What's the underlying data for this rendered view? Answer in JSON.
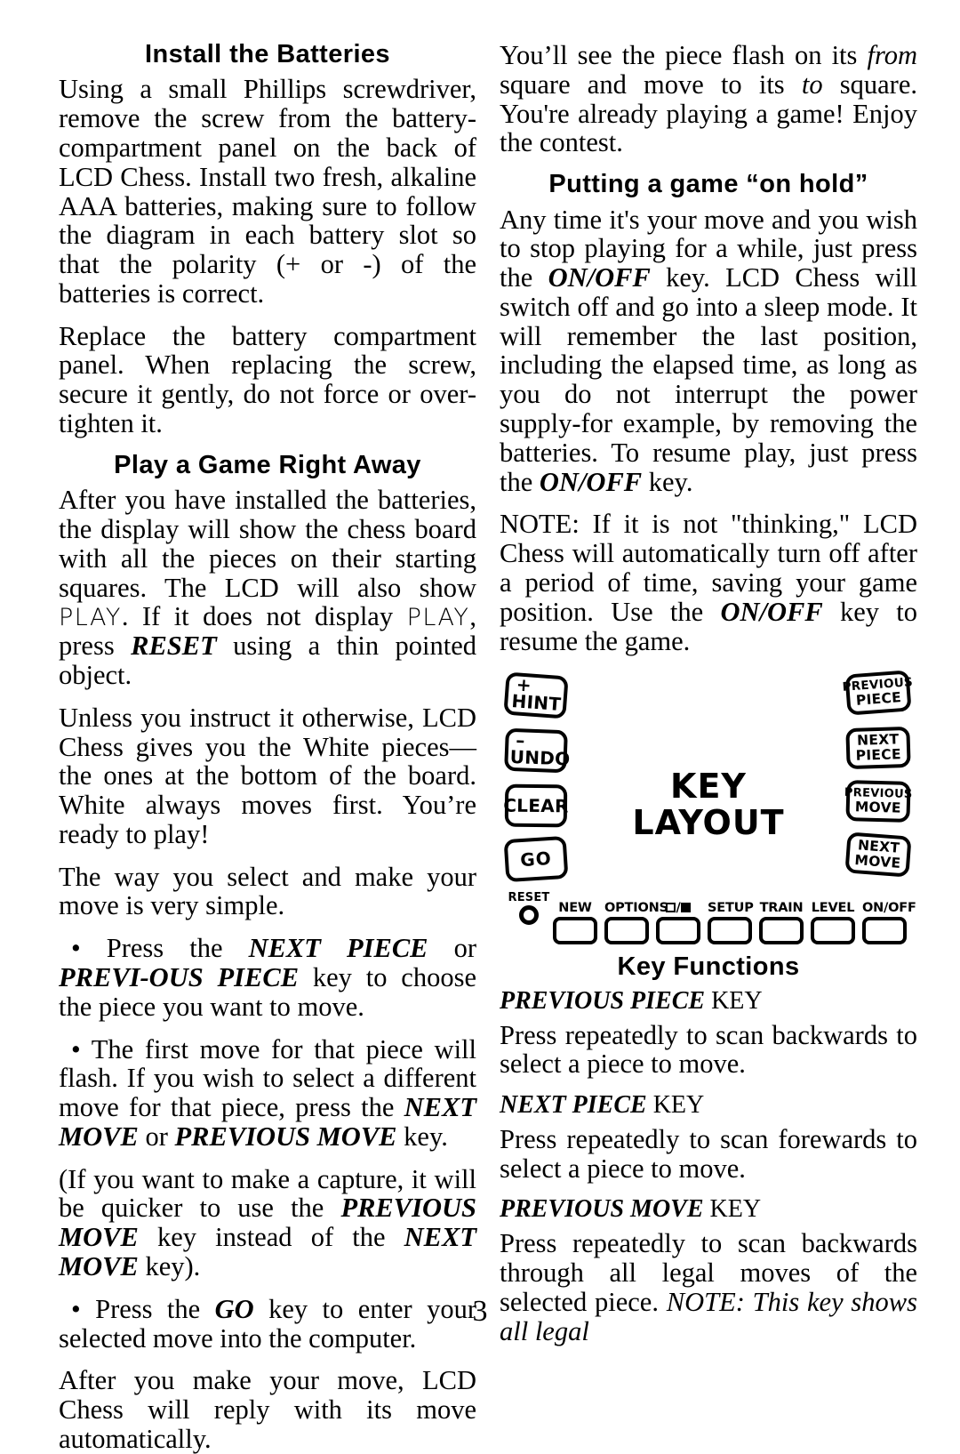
{
  "page_number": "3",
  "left_column": {
    "heading_1": "Install the Batteries",
    "para_1": "Using a small Phillips screwdriver, remove the screw from the battery-compartment panel on the back of LCD Chess.  Install two fresh, alkaline AAA batteries, making sure to follow the diagram in each battery slot so that the polarity (+ or -) of the batteries is correct.",
    "para_2": "Replace the battery compartment panel. When replacing the screw, secure it gently,  do not force or over-tighten it.",
    "heading_2": "Play a Game Right Away",
    "para_3_a": "After you have installed the batteries, the display will show the chess board with all the pieces on their starting squares. The LCD will also show ",
    "para_3_lcd1": "PLAY",
    "para_3_b": ". If it does not display ",
    "para_3_lcd2": "PLAY",
    "para_3_c": ", press ",
    "para_3_key": "RESET",
    "para_3_d": " using a thin pointed object.",
    "para_4": "Unless you instruct it otherwise, LCD Chess gives you the White pieces—the ones at the bottom of the board. White always moves first. You’re ready to play!",
    "para_5": "The way you select and make your move is very simple.",
    "bullet_1_a": "• Press the ",
    "bullet_1_key1": "NEXT PIECE",
    "bullet_1_b": " or ",
    "bullet_1_key2": "PREVI-OUS   PIECE",
    "bullet_1_c": " key to choose the piece you want to move.",
    "bullet_2_a": "• The first move for that piece will flash. If you wish to select a different move for that piece, press the ",
    "bullet_2_key1": "NEXT MOVE",
    "bullet_2_b": " or ",
    "bullet_2_key2": "PREVIOUS MOVE",
    "bullet_2_c": " key.",
    "para_6_a": "(If you want to make a capture, it will be quicker to use the ",
    "para_6_key1": "PREVIOUS MOVE",
    "para_6_b": " key instead of the ",
    "para_6_key2": "NEXT MOVE",
    "para_6_c": " key).",
    "bullet_3_a": "• Press the ",
    "bullet_3_key": "GO",
    "bullet_3_b": " key to enter your  selected move into the computer.",
    "para_7": "After you make your move, LCD Chess will reply with its move automatically."
  },
  "right_column": {
    "para_1_a": "You’ll see the piece flash on its ",
    "para_1_em1": "from",
    "para_1_b": " square and move to its ",
    "para_1_em2": "to",
    "para_1_c": " square. You're already playing a game! Enjoy the contest.",
    "heading_1": "Putting a game “on hold”",
    "para_2_a": "Any time it's your move and you wish to stop playing for a while, just press the ",
    "para_2_key1": "ON/OFF",
    "para_2_b": " key. LCD Chess will switch off and go into a sleep mode. It will remember the last position, including the elapsed time, as long as you do not interrupt the power supply-for example, by removing the batteries.  To resume play, just press the ",
    "para_2_key2": "ON/OFF",
    "para_2_c": " key.",
    "para_3_a": "NOTE: If it is not \"thinking,\" LCD Chess will automatically turn off after a period of time, saving your game position. Use the ",
    "para_3_key": "ON/OFF",
    "para_3_b": " key to resume the game.",
    "heading_2": "Key Functions",
    "functions": [
      {
        "name": "PREVIOUS PIECE",
        "key_word": " KEY",
        "text": "Press repeatedly to scan backwards to select a piece to move."
      },
      {
        "name": "NEXT PIECE",
        "key_word": " KEY",
        "text": "Press repeatedly to scan forewards to select a piece to move."
      },
      {
        "name": "PREVIOUS MOVE",
        "key_word": " KEY",
        "text_a": "Press repeatedly to scan backwards through all legal moves of the selected piece. ",
        "text_em": "NOTE: This key shows all legal"
      }
    ]
  },
  "key_layout": {
    "title_line1": "KEY",
    "title_line2": "LAYOUT",
    "left_keys": [
      {
        "sign": "+",
        "label": "HINT"
      },
      {
        "sign": "–",
        "label": "UNDO"
      },
      {
        "sign": "",
        "label": "CLEAR"
      },
      {
        "sign": "",
        "label": "GO"
      }
    ],
    "right_keys": [
      {
        "line1": "PREVIOUS",
        "line2": "PIECE"
      },
      {
        "line1": "NEXT",
        "line2": "PIECE"
      },
      {
        "line1": "PREVIOUS",
        "line2": "MOVE"
      },
      {
        "line1": "NEXT",
        "line2": "MOVE"
      }
    ],
    "reset_label": "RESET",
    "bottom_keys": [
      {
        "label": "NEW",
        "icon": ""
      },
      {
        "label": "OPTIONS",
        "icon": ""
      },
      {
        "label": "",
        "icon": "white-black-square"
      },
      {
        "label": "SETUP",
        "icon": ""
      },
      {
        "label": "TRAIN",
        "icon": ""
      },
      {
        "label": "LEVEL",
        "icon": ""
      },
      {
        "label": "ON/OFF",
        "icon": ""
      }
    ]
  }
}
